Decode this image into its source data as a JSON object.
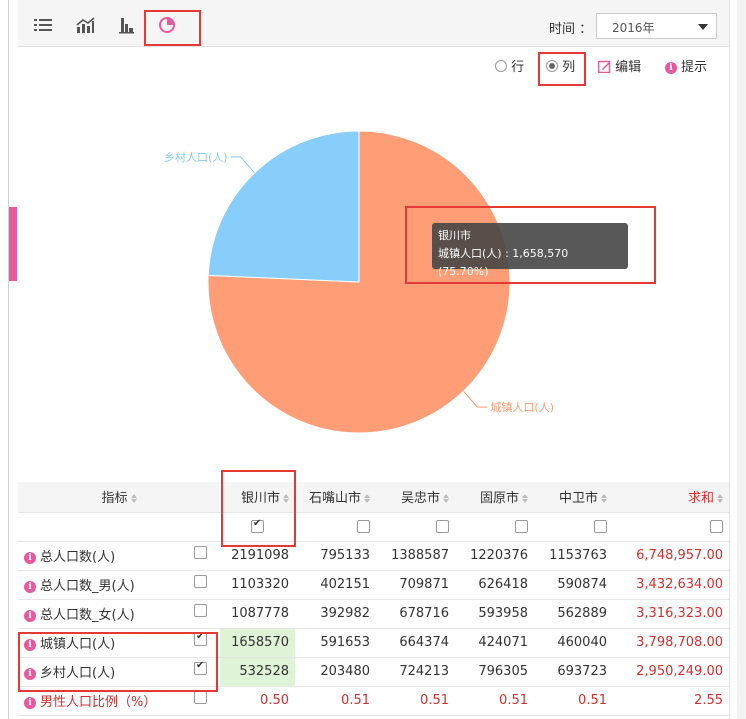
{
  "toolbar": {
    "icons": [
      "list-view-icon",
      "line-chart-icon",
      "bar-chart-icon",
      "pie-chart-icon"
    ],
    "time_label": "时间 ：",
    "time_value": "2016年"
  },
  "options": {
    "row_label": "行",
    "col_label": "列",
    "edit_label": "编辑",
    "hint_label": "提示",
    "selected": "列"
  },
  "chart_data": {
    "type": "pie",
    "slices": [
      {
        "label": "城镇人口(人)",
        "value": 1658570,
        "percent": 75.7,
        "color": "#ff9e76"
      },
      {
        "label": "乡村人口(人)",
        "value": 532528,
        "percent": 24.3,
        "color": "#87cefa"
      }
    ],
    "tooltip": {
      "title": "银川市",
      "text": "城镇人口(人) : 1,658,570 (75.70%)"
    }
  },
  "table": {
    "header": {
      "indicator": "指标",
      "cities": [
        "银川市",
        "石嘴山市",
        "吴忠市",
        "固原市",
        "中卫市"
      ],
      "sum": "求和"
    },
    "column_checks": [
      true,
      false,
      false,
      false,
      false,
      false
    ],
    "rows": [
      {
        "name": "总人口数(人)",
        "checked": false,
        "values": [
          "2191098",
          "795133",
          "1388587",
          "1220376",
          "1153763"
        ],
        "sum": "6,748,957.00"
      },
      {
        "name": "总人口数_男(人)",
        "checked": false,
        "values": [
          "1103320",
          "402151",
          "709871",
          "626418",
          "590874"
        ],
        "sum": "3,432,634.00"
      },
      {
        "name": "总人口数_女(人)",
        "checked": false,
        "values": [
          "1087778",
          "392982",
          "678716",
          "593958",
          "562889"
        ],
        "sum": "3,316,323.00"
      },
      {
        "name": "城镇人口(人)",
        "checked": true,
        "values": [
          "1658570",
          "591653",
          "664374",
          "424071",
          "460040"
        ],
        "sum": "3,798,708.00"
      },
      {
        "name": "乡村人口(人)",
        "checked": true,
        "values": [
          "532528",
          "203480",
          "724213",
          "796305",
          "693723"
        ],
        "sum": "2,950,249.00"
      },
      {
        "name": "男性人口比例（%）",
        "checked": false,
        "values": [
          "0.50",
          "0.51",
          "0.51",
          "0.51",
          "0.51"
        ],
        "sum": "2.55"
      }
    ]
  }
}
